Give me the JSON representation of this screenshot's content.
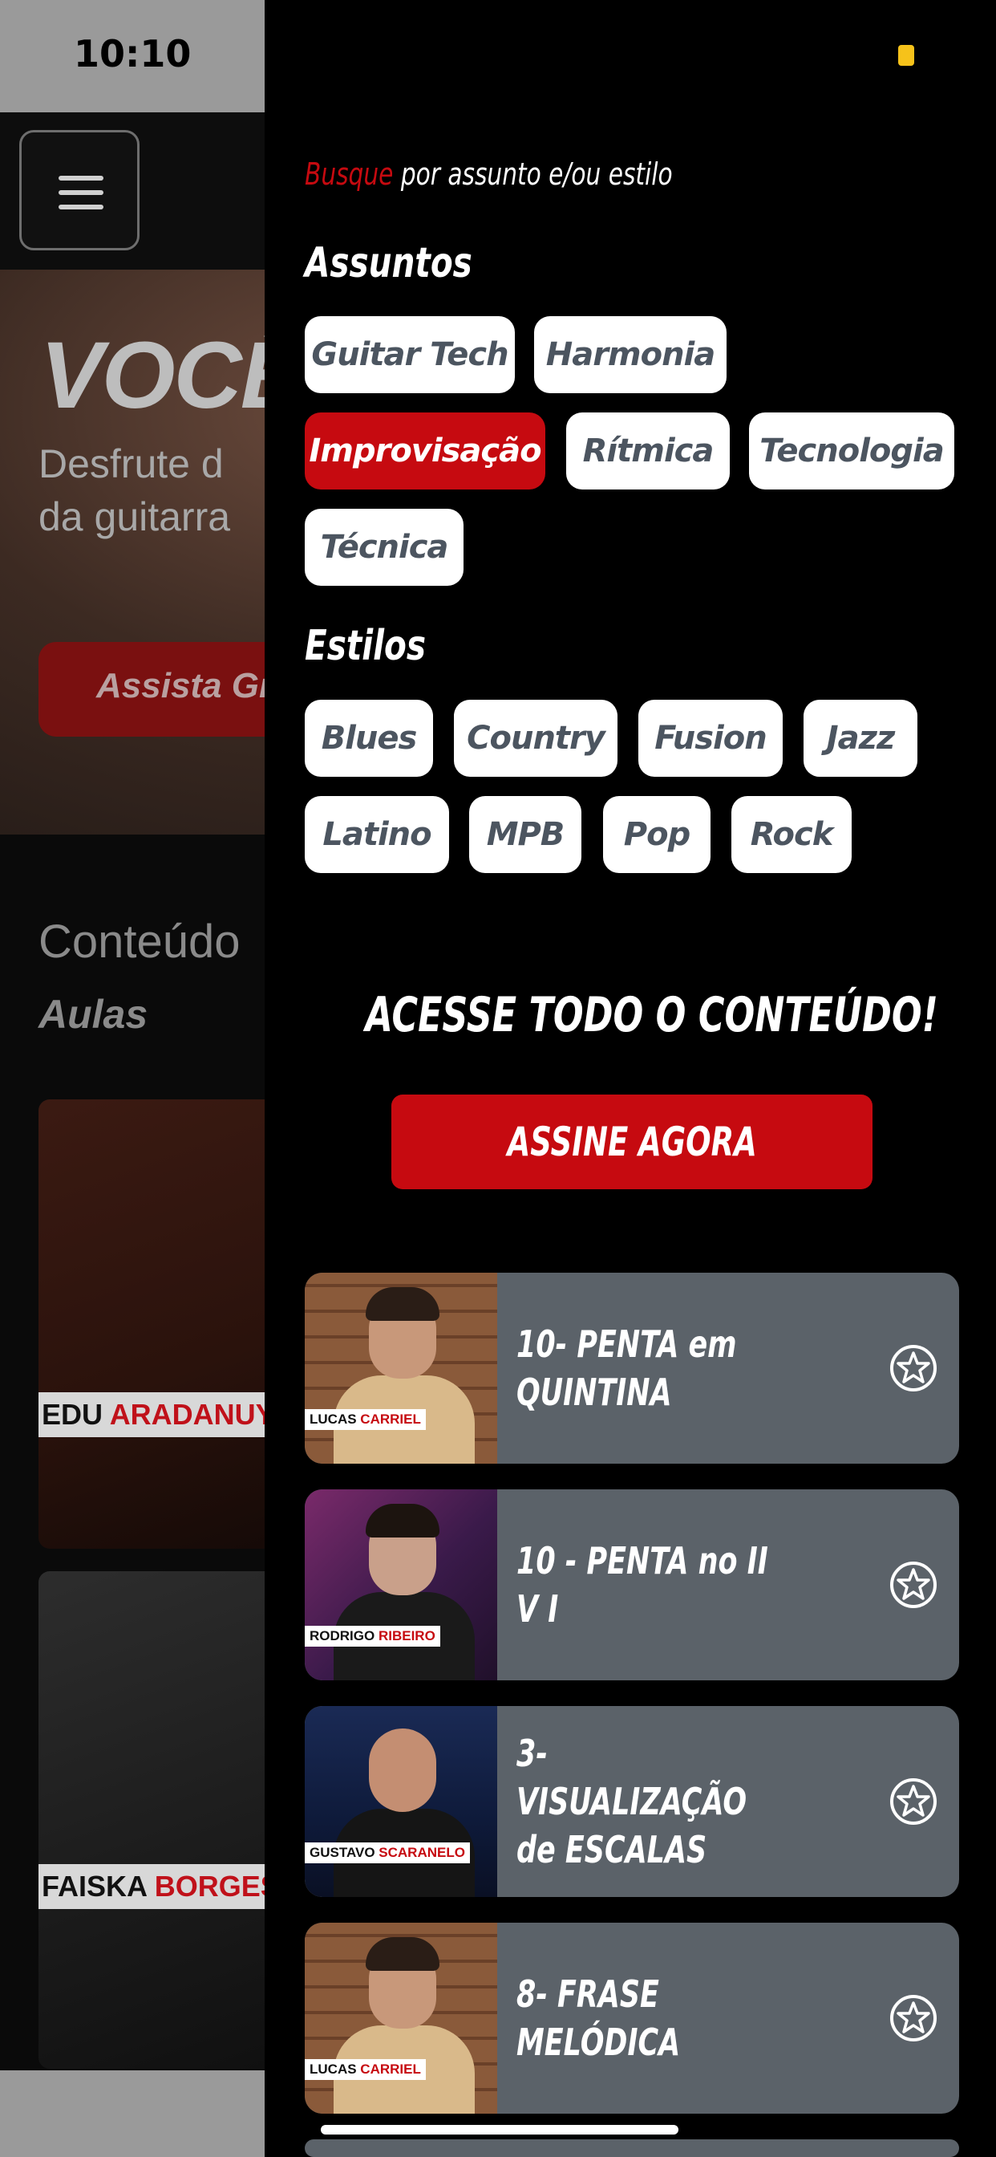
{
  "status_bar": {
    "time": "10:10"
  },
  "background": {
    "hero_title": "VOCÊ É",
    "hero_subtitle": "Desfrute d\nda guitarra",
    "hero_cta": "Assista Grá",
    "section_title": "Conteúdo",
    "section_subtitle": "Aulas",
    "cards": [
      {
        "name_first": "EDU",
        "name_last": "ARADANUY"
      },
      {
        "name_first": "FAISKA",
        "name_last": "BORGES"
      }
    ]
  },
  "drawer": {
    "search_hint_accent": "Busque",
    "search_hint_rest": " por assunto e/ou estilo",
    "subjects_heading": "Assuntos",
    "subjects": [
      {
        "label": "Guitar Tech",
        "active": false
      },
      {
        "label": "Harmonia",
        "active": false
      },
      {
        "label": "Improvisação",
        "active": true
      },
      {
        "label": "Rítmica",
        "active": false
      },
      {
        "label": "Tecnologia",
        "active": false
      },
      {
        "label": "Técnica",
        "active": false
      }
    ],
    "styles_heading": "Estilos",
    "styles": [
      {
        "label": "Blues"
      },
      {
        "label": "Country"
      },
      {
        "label": "Fusion"
      },
      {
        "label": "Jazz"
      },
      {
        "label": "Latino"
      },
      {
        "label": "MPB"
      },
      {
        "label": "Pop"
      },
      {
        "label": "Rock"
      }
    ],
    "cta_heading": "ACESSE TODO O CONTEÚDO!",
    "subscribe_label": "ASSINE AGORA",
    "lessons": [
      {
        "title": "10- PENTA em QUINTINA",
        "teacher_first": "LUCAS",
        "teacher_last": "CARRIEL",
        "favorite_icon": "star-circle-icon"
      },
      {
        "title": "10 - PENTA no II V I",
        "teacher_first": "RODRIGO",
        "teacher_last": "RIBEIRO",
        "favorite_icon": "star-circle-icon"
      },
      {
        "title": "3- VISUALIZAÇÃO de ESCALAS",
        "teacher_first": "GUSTAVO",
        "teacher_last": "SCARANELO",
        "favorite_icon": "star-circle-icon"
      },
      {
        "title": "8- FRASE MELÓDICA",
        "teacher_first": "LUCAS",
        "teacher_last": "CARRIEL",
        "favorite_icon": "star-circle-icon"
      }
    ]
  },
  "colors": {
    "accent_red": "#c60a10",
    "chip_text": "#4c5560",
    "lesson_card_bg": "#5b6269",
    "battery": "#f6c21a"
  }
}
